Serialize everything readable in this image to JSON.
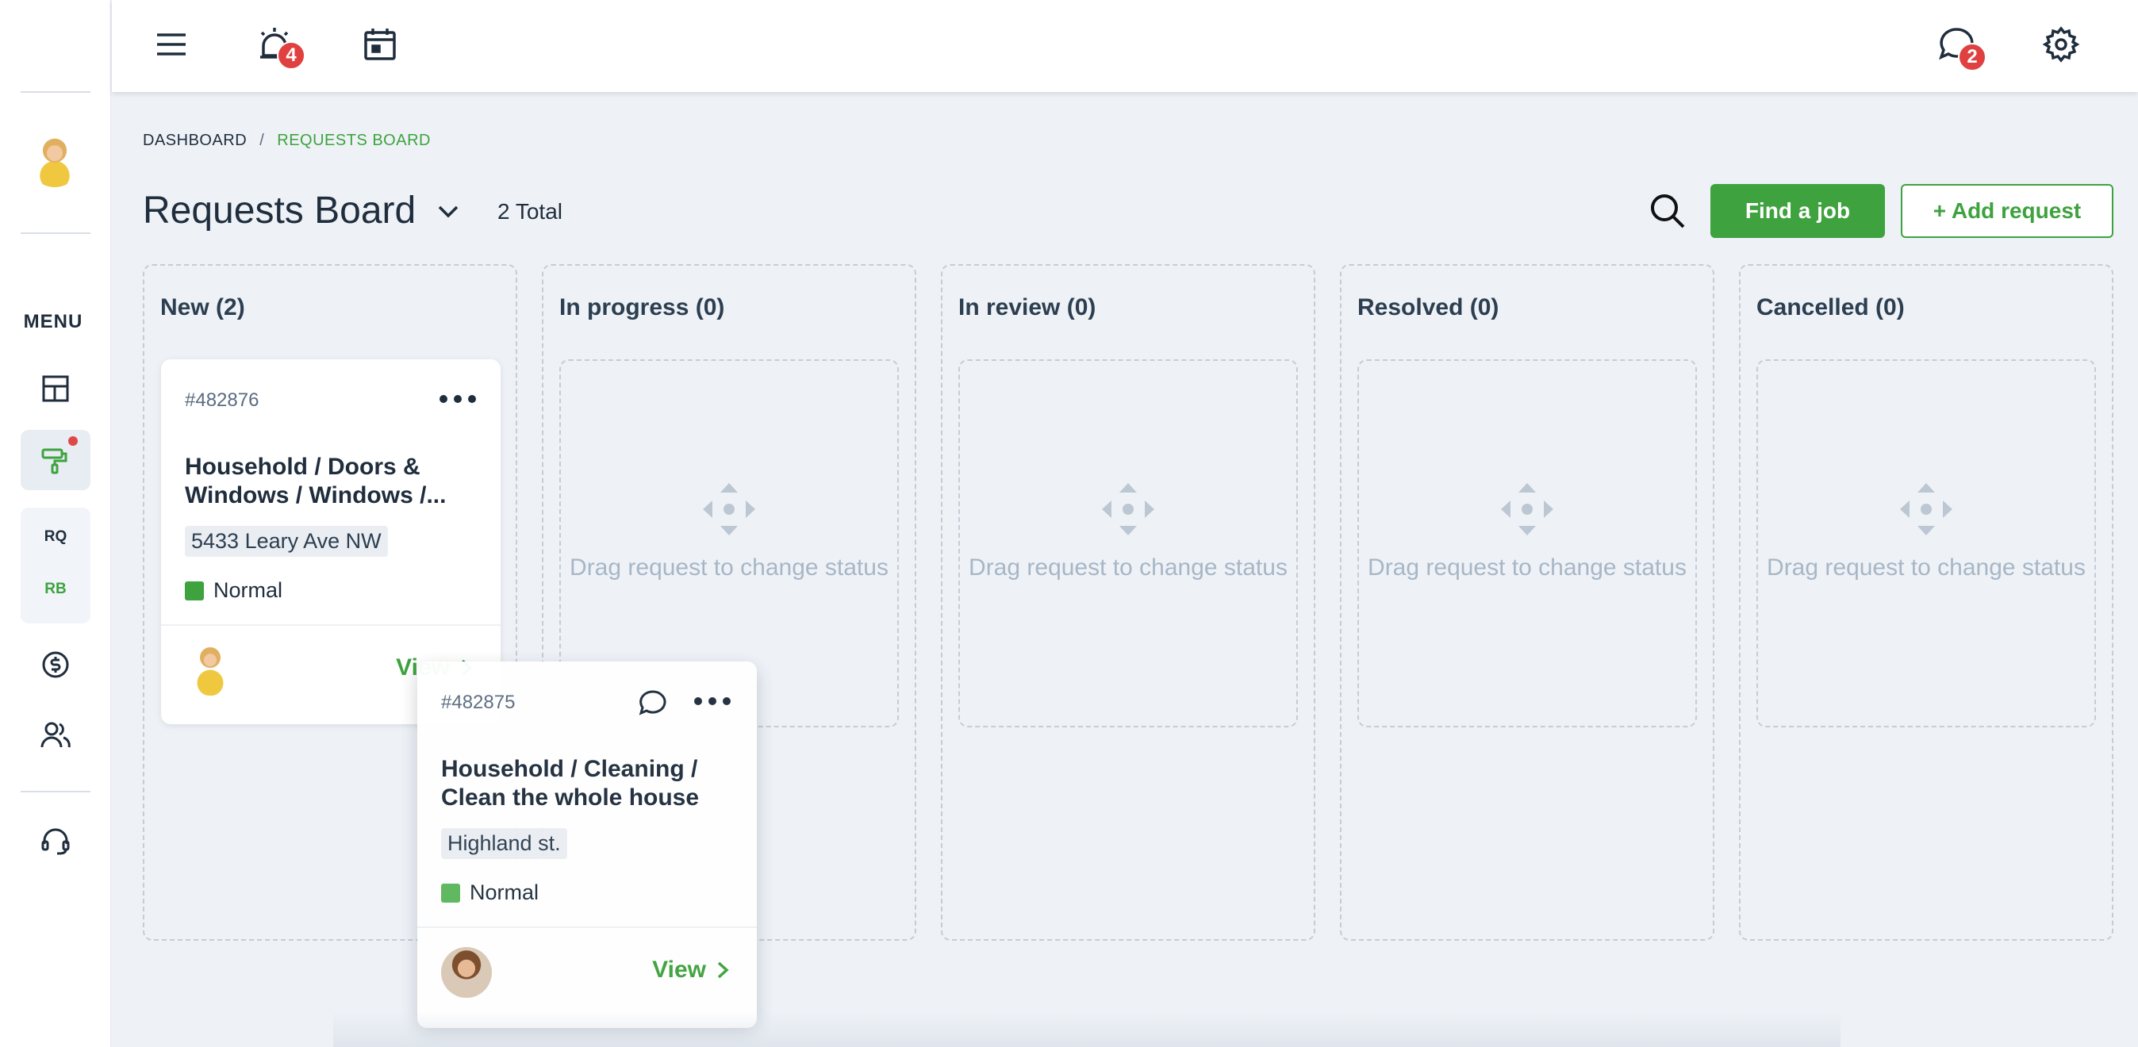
{
  "app": {
    "sidebar": {
      "menu_label": "MENU",
      "sub_items": [
        "RQ",
        "RB"
      ]
    },
    "topbar": {
      "alerts_badge": "4",
      "messages_badge": "2"
    }
  },
  "breadcrumb": {
    "items": [
      "DASHBOARD",
      "REQUESTS BOARD"
    ],
    "separator": "/"
  },
  "header": {
    "title": "Requests Board",
    "total": "2 Total",
    "find_job_label": "Find a job",
    "add_request_label": "+ Add request"
  },
  "columns": [
    {
      "title": "New (2)"
    },
    {
      "title": "In progress (0)",
      "empty_text": "Drag request to change status"
    },
    {
      "title": "In review (0)",
      "empty_text": "Drag request to change status"
    },
    {
      "title": "Resolved (0)",
      "empty_text": "Drag request to change status"
    },
    {
      "title": "Cancelled (0)",
      "empty_text": "Drag request to change status"
    }
  ],
  "cards": [
    {
      "id": "#482876",
      "title": "Household / Doors & Windows / Windows /...",
      "address": "5433 Leary Ave NW",
      "priority": "Normal",
      "view_label": "View"
    },
    {
      "id": "#482875",
      "title": "Household / Cleaning / Clean the whole house",
      "address": "Highland st.",
      "priority": "Normal",
      "view_label": "View"
    }
  ],
  "colors": {
    "accent": "#3ea23e",
    "badge": "#e04040",
    "text": "#1f2d3d",
    "placeholder": "#a7b6c6"
  }
}
